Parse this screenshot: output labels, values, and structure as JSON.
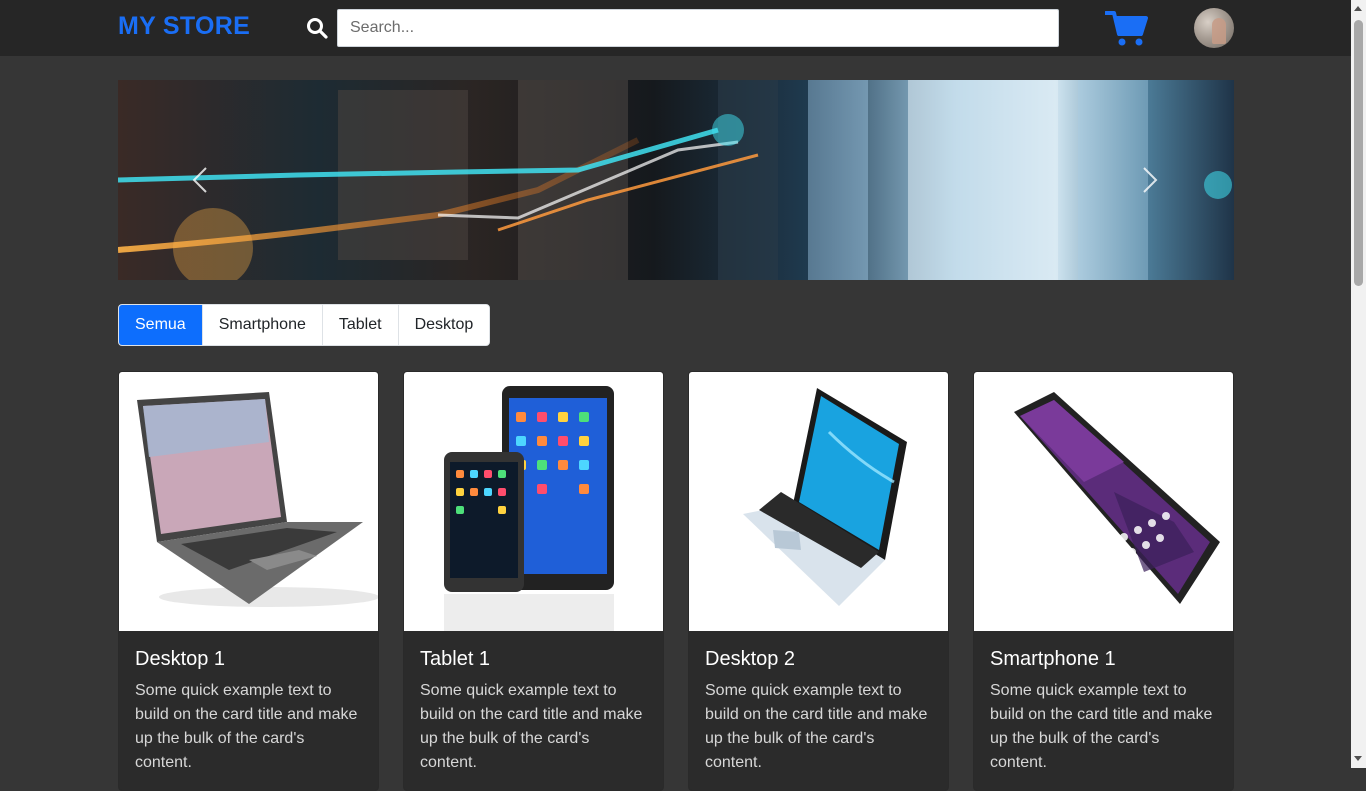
{
  "navbar": {
    "brand": "MY STORE",
    "search_placeholder": "Search...",
    "search_value": "",
    "icons": {
      "search": "search-icon",
      "cart": "cart-icon",
      "avatar": "user-avatar"
    },
    "accent_color": "#1a6ef5"
  },
  "carousel": {
    "prev_icon": "chevron-left-icon",
    "next_icon": "chevron-right-icon"
  },
  "tabs": [
    {
      "label": "Semua",
      "active": true
    },
    {
      "label": "Smartphone",
      "active": false
    },
    {
      "label": "Tablet",
      "active": false
    },
    {
      "label": "Desktop",
      "active": false
    }
  ],
  "products": [
    {
      "title": "Desktop 1",
      "text": "Some quick example text to build on the card title and make up the bulk of the card's content.",
      "image": "laptop-photo"
    },
    {
      "title": "Tablet 1",
      "text": "Some quick example text to build on the card title and make up the bulk of the card's content.",
      "image": "tablet-phone-photo"
    },
    {
      "title": "Desktop 2",
      "text": "Some quick example text to build on the card title and make up the bulk of the card's content.",
      "image": "silver-laptop-photo"
    },
    {
      "title": "Smartphone 1",
      "text": "Some quick example text to build on the card title and make up the bulk of the card's content.",
      "image": "smartphone-photo"
    }
  ]
}
